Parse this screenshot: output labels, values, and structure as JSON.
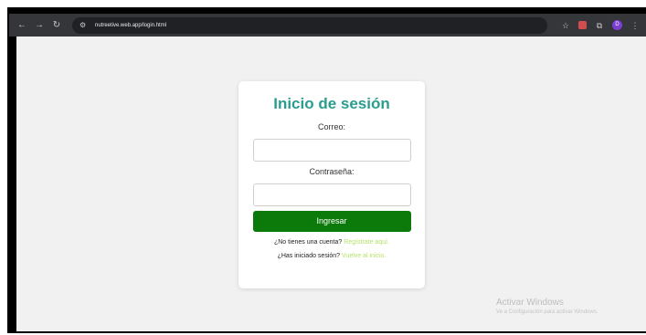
{
  "browser": {
    "url": "nutreetive.web.app/login.html",
    "icons": {
      "back": "arrow-left-icon",
      "forward": "arrow-right-icon",
      "reload": "reload-icon",
      "site": "site-settings-icon",
      "bookmark": "star-icon",
      "extensions": "puzzle-icon",
      "profile": "avatar"
    },
    "profile_initial": "D"
  },
  "login": {
    "title": "Inicio de sesión",
    "email_label": "Correo:",
    "email_value": "",
    "password_label": "Contraseña:",
    "password_value": "",
    "submit_label": "Ingresar",
    "no_account_text": "¿No tienes una cuenta?",
    "register_link": "Regístrate aquí.",
    "logged_in_text": "¿Has iniciado sesión?",
    "home_link": "Vuelve al inicio."
  },
  "watermark": {
    "title": "Activar Windows",
    "subtitle": "Ve a Configuración para activar Windows."
  },
  "colors": {
    "title": "#2a9d8f",
    "button": "#0b7a0b",
    "link": "#b7e36a",
    "page_bg": "#f1f1f1"
  }
}
